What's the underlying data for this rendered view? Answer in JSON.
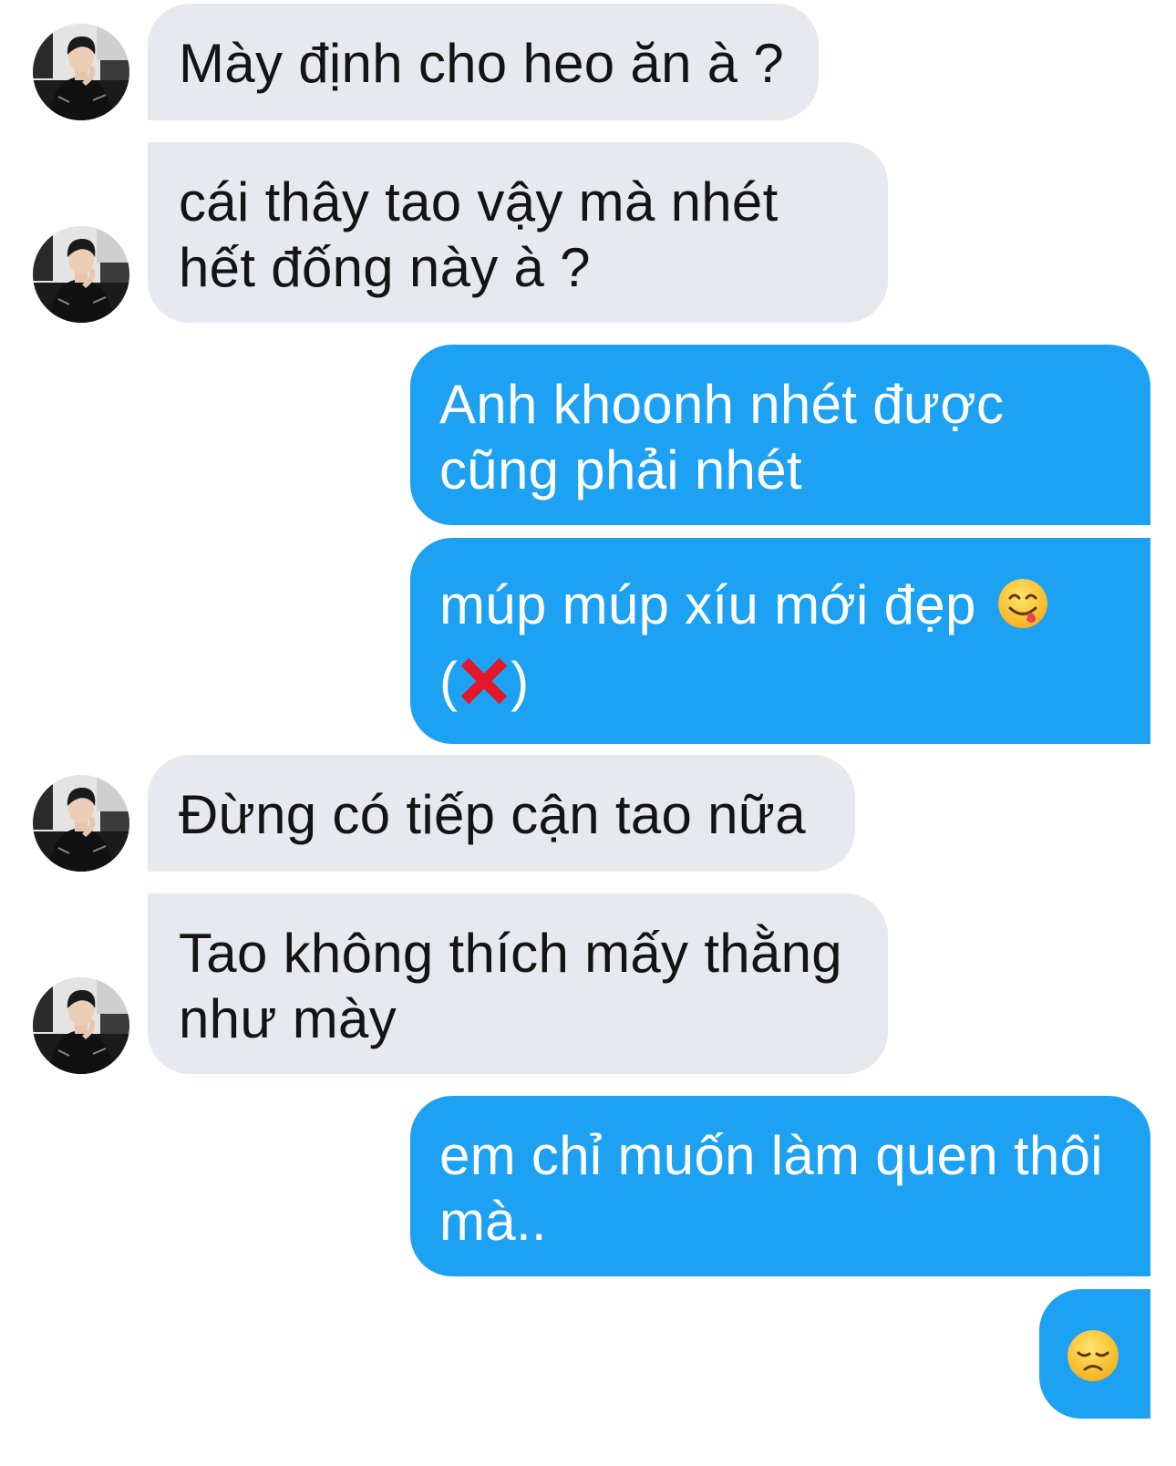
{
  "conversation": {
    "messages": [
      {
        "sender": "other",
        "line1": "Mày định cho heo ăn à ?"
      },
      {
        "sender": "other",
        "line1": "cái thây tao vậy mà nhét",
        "line2": "hết đống này à ?"
      },
      {
        "sender": "me",
        "line1": "Anh khoonh nhét được",
        "line2": "cũng phải nhét"
      },
      {
        "sender": "me",
        "line1": "múp múp xíu mới đẹp",
        "emoji": "smiling-face-savoring-food-icon",
        "line2_open": "(",
        "line2_emoji": "cross-mark-icon",
        "line2_close": ")"
      },
      {
        "sender": "other",
        "line1": "Đừng có tiếp cận tao nữa"
      },
      {
        "sender": "other",
        "line1": "Tao không thích mấy thằng",
        "line2": "như mày"
      },
      {
        "sender": "me",
        "line1": "em chỉ muốn làm quen thôi",
        "line2": "mà.."
      },
      {
        "sender": "me",
        "emoji": "disappointed-face-icon"
      }
    ]
  },
  "colors": {
    "incoming_bubble": "#e6e9ee",
    "outgoing_bubble": "#1da1f2",
    "incoming_text": "#141414",
    "outgoing_text": "#ffffff",
    "emoji_cross": "#e2172a",
    "emoji_face": "#ffcc33"
  }
}
